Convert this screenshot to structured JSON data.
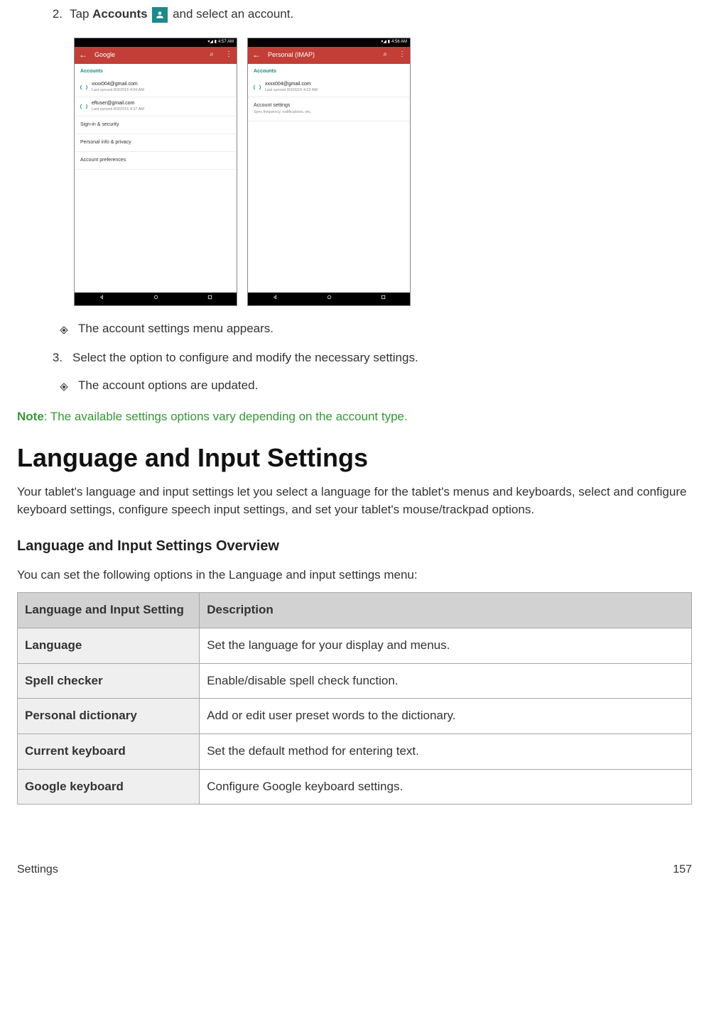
{
  "step2": {
    "num": "2.",
    "pre": "Tap ",
    "bold": "Accounts",
    "post": " and select an account."
  },
  "screens": {
    "status_time_a": "4:57 AM",
    "status_time_b": "4:56 AM",
    "app_a_title": "Google",
    "app_b_title": "Personal (IMAP)",
    "section_label": "Accounts",
    "a_rows": [
      {
        "email": "xxxx004@gmail.com",
        "sync": "Last synced 8/3/2015 4:56 AM"
      },
      {
        "email": "eftuser@gmail.com",
        "sync": "Last synced 8/3/2015 4:37 AM"
      }
    ],
    "a_list": [
      "Sign-in & security",
      "Personal info & privacy",
      "Account preferences"
    ],
    "b_row": {
      "email": "xxxx004@gmail.com",
      "sync": "Last synced 8/3/2015 4:23 AM"
    },
    "b_setting": {
      "title": "Account settings",
      "sub": "Sync frequency, notifications, etc."
    }
  },
  "bullet1": "The account settings menu appears.",
  "step3": {
    "num": "3.",
    "text": "Select the option to configure and modify the necessary settings."
  },
  "bullet2": "The account options are updated.",
  "note": {
    "label": "Note",
    "rest": ": The available settings options vary depending on the account type."
  },
  "h1": "Language and Input Settings",
  "intro": "Your tablet's language and input settings let you select a language for the tablet's menus and keyboards, select and configure keyboard settings, configure speech input settings, and set your tablet's mouse/trackpad options.",
  "h2": "Language and Input Settings Overview",
  "overview_intro": "You can set the following options in the Language and input settings menu:",
  "table": {
    "head": [
      "Language and Input Setting",
      "Description"
    ],
    "rows": [
      [
        "Language",
        "Set the language for your display and menus."
      ],
      [
        "Spell checker",
        "Enable/disable spell check function."
      ],
      [
        "Personal dictionary",
        "Add or edit user preset words to the dictionary."
      ],
      [
        "Current keyboard",
        "Set the default method for entering text."
      ],
      [
        "Google keyboard",
        "Configure Google keyboard settings."
      ]
    ]
  },
  "footer": {
    "left": "Settings",
    "right": "157"
  }
}
